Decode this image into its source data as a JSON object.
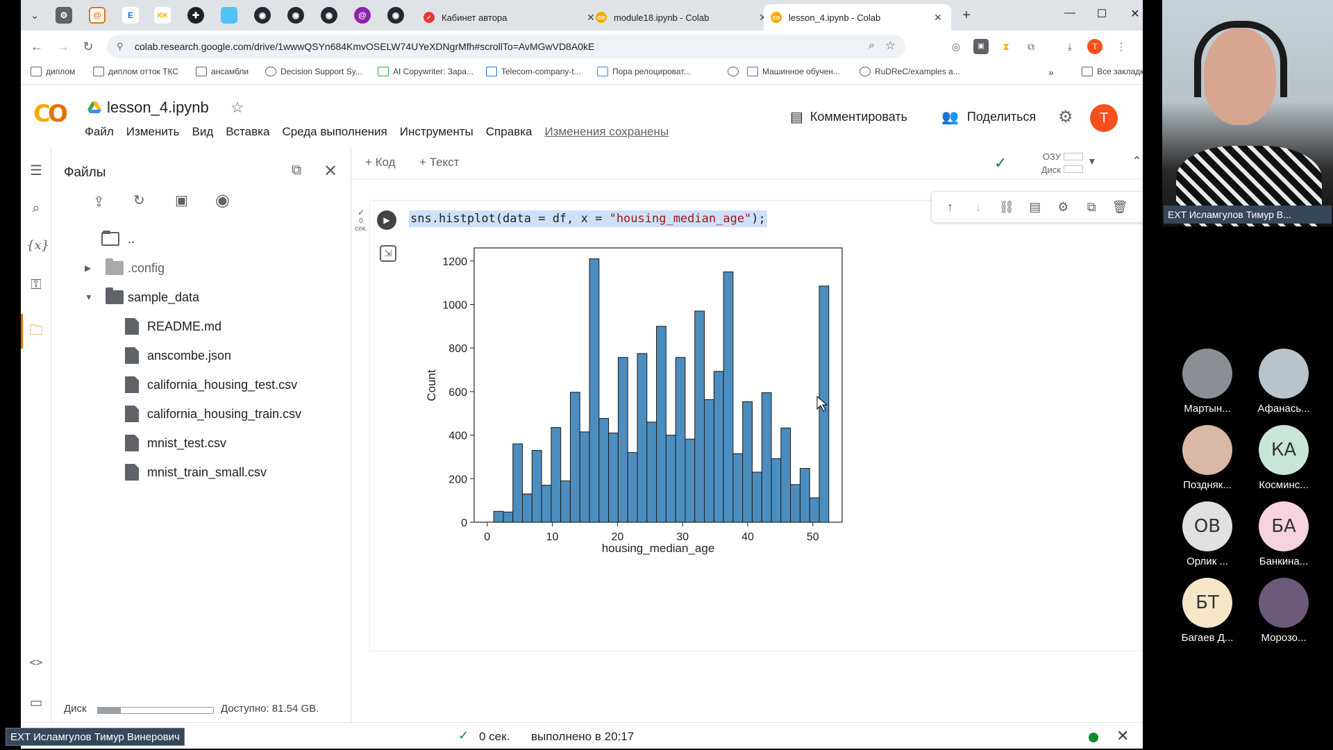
{
  "browser": {
    "tabs": [
      {
        "title": "Кабинет автора",
        "color": "#e53935"
      },
      {
        "title": "module18.ipynb - Colab",
        "color": "#f9ab00"
      },
      {
        "title": "lesson_4.ipynb - Colab",
        "color": "#f9ab00",
        "active": true
      }
    ],
    "url": "colab.research.google.com/drive/1wwwQSYn684KmvOSELW74UYeXDNgrMfh#scrollTo=AvMGwVD8A0kE",
    "bookmarks": [
      "диплом",
      "диплом отток ТКС",
      "ансамбли",
      "Decision Support Sy...",
      "AI Copywriter: Зара...",
      "Telecom-company-t...",
      "Пора релоцироват...",
      "Машинное обучен...",
      "RuDReC/examples a..."
    ],
    "all_bookmarks": "Все закладки"
  },
  "colab": {
    "notebook_name": "lesson_4.ipynb",
    "menu": [
      "Файл",
      "Изменить",
      "Вид",
      "Вставка",
      "Среда выполнения",
      "Инструменты",
      "Справка"
    ],
    "saved_status": "Изменения сохранены",
    "comment_label": "Комментировать",
    "share_label": "Поделиться",
    "avatar_letter": "T",
    "add_code": "+ Код",
    "add_text": "+ Текст",
    "ram_label": "ОЗУ",
    "disk_label": "Диск"
  },
  "files_panel": {
    "title": "Файлы",
    "tree": [
      {
        "name": "..",
        "type": "folder",
        "level": 0
      },
      {
        "name": ".config",
        "type": "folder",
        "level": 0,
        "caret": "▶"
      },
      {
        "name": "sample_data",
        "type": "folder",
        "level": 0,
        "caret": "▼"
      },
      {
        "name": "README.md",
        "type": "file",
        "level": 1
      },
      {
        "name": "anscombe.json",
        "type": "file",
        "level": 1
      },
      {
        "name": "california_housing_test.csv",
        "type": "file",
        "level": 1
      },
      {
        "name": "california_housing_train.csv",
        "type": "file",
        "level": 1
      },
      {
        "name": "mnist_test.csv",
        "type": "file",
        "level": 1
      },
      {
        "name": "mnist_train_small.csv",
        "type": "file",
        "level": 1
      }
    ],
    "disk_label": "Диск",
    "disk_used_fraction": 0.2,
    "disk_available": "Доступно: 81.54 GB."
  },
  "cell": {
    "exec_time_small": "0",
    "exec_unit_small": "сек.",
    "code_prefix": "sns.histplot(data = df, x = ",
    "code_string": "\"housing_median_age\"",
    "code_suffix": ");"
  },
  "chart_data": {
    "type": "bar",
    "title": "",
    "xlabel": "housing_median_age",
    "ylabel": "Count",
    "xlim": [
      -2,
      54.5
    ],
    "ylim": [
      0,
      1260
    ],
    "xticks": [
      0,
      10,
      20,
      30,
      40,
      50
    ],
    "yticks": [
      0,
      200,
      400,
      600,
      800,
      1000,
      1200
    ],
    "bar_color": "#4c8dbf",
    "bin_width": 1.47,
    "bin_start": 1,
    "values": [
      50,
      47,
      360,
      130,
      330,
      170,
      435,
      190,
      597,
      415,
      1210,
      477,
      410,
      757,
      320,
      775,
      460,
      900,
      400,
      757,
      382,
      970,
      563,
      693,
      1150,
      315,
      554,
      230,
      595,
      292,
      433,
      173,
      247,
      112,
      1085
    ]
  },
  "statusbar": {
    "time": "0 сек.",
    "done": "выполнено в 20:17",
    "presenter": "EXT Исламгулов Тимур Винерович"
  },
  "call": {
    "speaker": "EXT Исламгулов Тимур В...",
    "participants": [
      {
        "name": "Мартын...",
        "initials": "",
        "color": "#8a8f96"
      },
      {
        "name": "Афанась...",
        "initials": "",
        "color": "#b9c3cc"
      },
      {
        "name": "Поздняк...",
        "initials": "",
        "color": "#d9b8a6"
      },
      {
        "name": "Косминс...",
        "initials": "КА",
        "color": "#c8e6d7"
      },
      {
        "name": "Орлик ...",
        "initials": "ОВ",
        "color": "#e0e0e0"
      },
      {
        "name": "Банкина...",
        "initials": "БА",
        "color": "#f6d3dd"
      },
      {
        "name": "Багаев Д...",
        "initials": "БТ",
        "color": "#f5e6c8"
      },
      {
        "name": "Морозо...",
        "initials": "",
        "color": "#6b5a7a"
      }
    ]
  }
}
